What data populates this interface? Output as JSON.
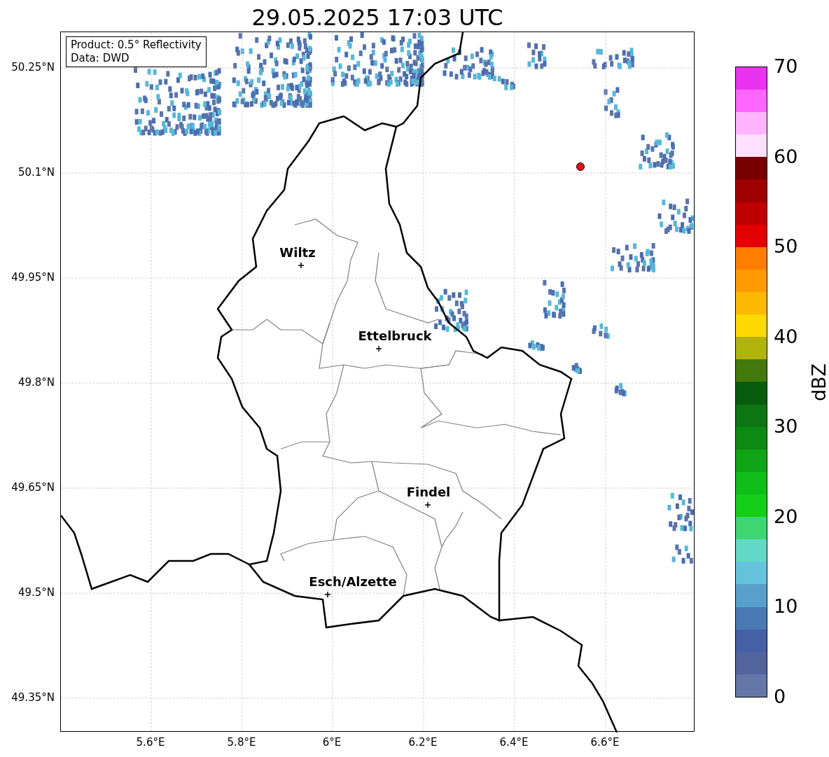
{
  "title": "29.05.2025 17:03 UTC",
  "info_box": [
    "Product: 0.5° Reflectivity",
    "Data: DWD"
  ],
  "lat_labels": [
    "50.25°N",
    "50.1°N",
    "49.95°N",
    "49.8°N",
    "49.65°N",
    "49.5°N",
    "49.35°N"
  ],
  "lon_labels": [
    "5.6°E",
    "5.8°E",
    "6°E",
    "6.2°E",
    "6.4°E",
    "6.6°E"
  ],
  "cities": [
    "Wiltz",
    "Ettelbruck",
    "Findel",
    "Esch/Alzette"
  ],
  "colorbar": {
    "label": "dBZ",
    "ticks": [
      "70",
      "60",
      "50",
      "40",
      "30",
      "20",
      "10",
      "0"
    ],
    "bins": [
      {
        "color": "#6577a8"
      },
      {
        "color": "#51649e"
      },
      {
        "color": "#4560a4"
      },
      {
        "color": "#4a7ab4"
      },
      {
        "color": "#58a0cc"
      },
      {
        "color": "#66c3de"
      },
      {
        "color": "#62d8c8"
      },
      {
        "color": "#3ed66e"
      },
      {
        "color": "#14ce18"
      },
      {
        "color": "#10be1a"
      },
      {
        "color": "#0ea416"
      },
      {
        "color": "#0d8a12"
      },
      {
        "color": "#0c7612"
      },
      {
        "color": "#095c0e"
      },
      {
        "color": "#447a0c"
      },
      {
        "color": "#b0b30a"
      },
      {
        "color": "#fed800"
      },
      {
        "color": "#fdb900"
      },
      {
        "color": "#ff9b00"
      },
      {
        "color": "#ff7d00"
      },
      {
        "color": "#e30000"
      },
      {
        "color": "#c00000"
      },
      {
        "color": "#9d0000"
      },
      {
        "color": "#7a0000"
      },
      {
        "color": "#ffdfff"
      },
      {
        "color": "#ffb4ff"
      },
      {
        "color": "#ff66ff"
      },
      {
        "color": "#e933f0"
      }
    ]
  }
}
